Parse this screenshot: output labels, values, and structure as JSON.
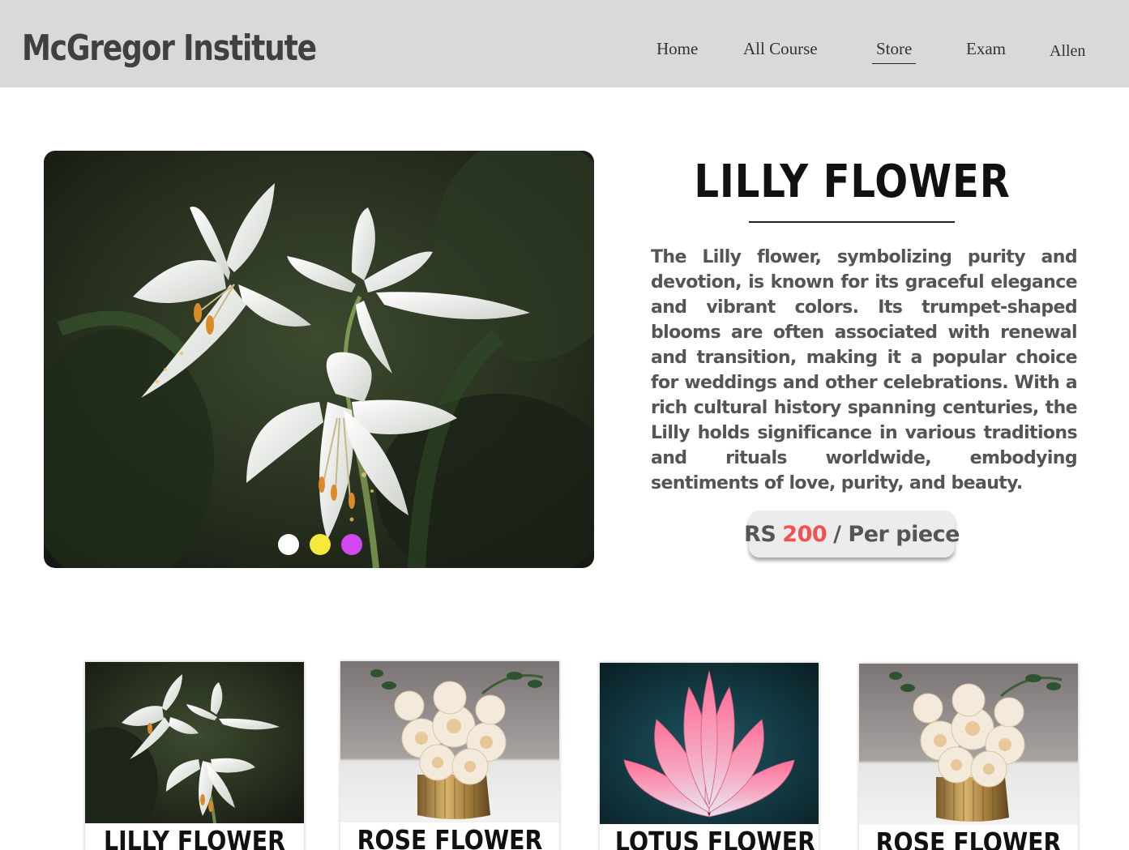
{
  "header": {
    "brand": "McGregor Institute",
    "nav": [
      {
        "label": "Home"
      },
      {
        "label": "All Course"
      },
      {
        "label": "Store"
      },
      {
        "label": "Exam"
      }
    ],
    "user": "Allen",
    "active_nav": "Store",
    "background": "#d9d9d9"
  },
  "product": {
    "title": "LILLY FLOWER",
    "description": "The Lilly flower, symbolizing purity and devotion, is known for its graceful elegance and vibrant colors. Its trumpet-shaped blooms are often associated with renewal and transition, making it a popular choice for weddings and other celebrations. With a rich cultural history spanning centuries, the Lilly holds significance in various traditions and rituals worldwide, embodying sentiments of love, purity, and beauty.",
    "price": {
      "currency": "RS",
      "amount": "200",
      "unit": "/ Per piece",
      "amount_color": "#f25151"
    },
    "carousel_dots": [
      {
        "color": "#ffffff"
      },
      {
        "color": "#f5e93b"
      },
      {
        "color": "#d347f0"
      }
    ],
    "image": "white-lily-photo"
  },
  "cards": [
    {
      "title": "LILLY FLOWER",
      "image": "white-lily-photo"
    },
    {
      "title": "ROSE FLOWER",
      "image": "white-roses-vase-photo"
    },
    {
      "title": "LOTUS FLOWER",
      "image": "pink-lotus-photo"
    },
    {
      "title": "ROSE FLOWER",
      "image": "white-roses-vase-photo"
    }
  ]
}
